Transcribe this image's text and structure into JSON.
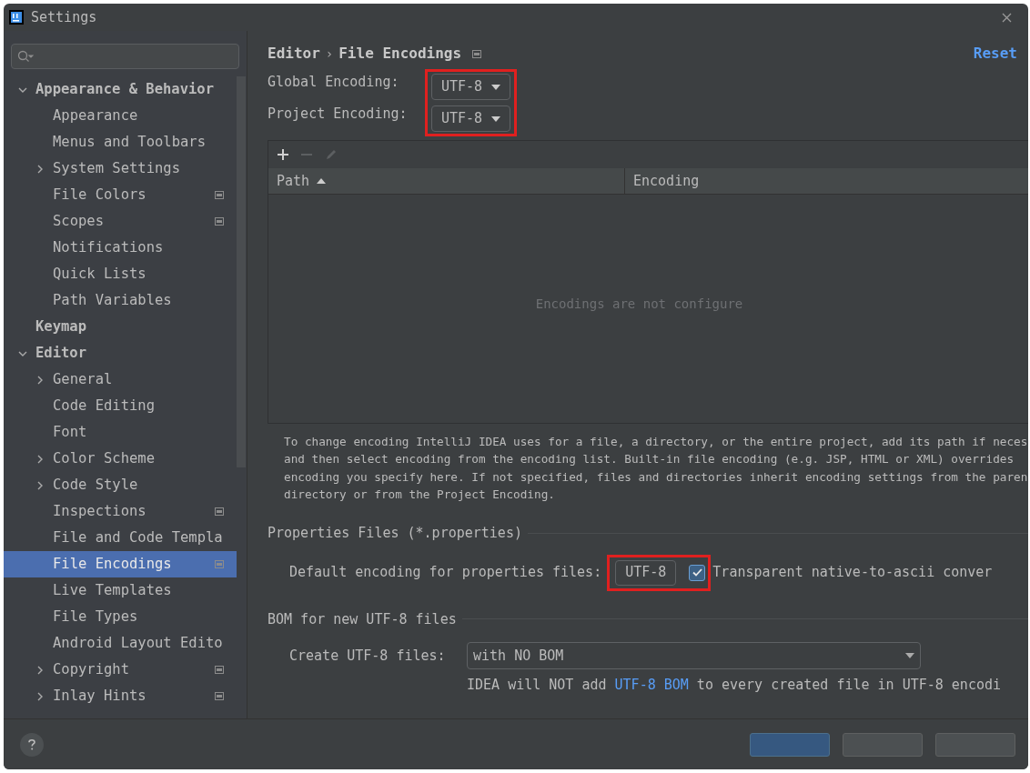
{
  "window": {
    "title": "Settings"
  },
  "sidebar": {
    "items": [
      {
        "label": "Appearance & Behavior",
        "bold": true,
        "expanded": true,
        "selected": false,
        "children": [
          {
            "label": "Appearance",
            "selected": false
          },
          {
            "label": "Menus and Toolbars",
            "selected": false
          },
          {
            "label": "System Settings",
            "expanded": false,
            "selected": false
          },
          {
            "label": "File Colors",
            "project_scope": true,
            "selected": false
          },
          {
            "label": "Scopes",
            "project_scope": true,
            "selected": false
          },
          {
            "label": "Notifications",
            "selected": false
          },
          {
            "label": "Quick Lists",
            "selected": false
          },
          {
            "label": "Path Variables",
            "selected": false
          }
        ]
      },
      {
        "label": "Keymap",
        "bold": true,
        "selected": false
      },
      {
        "label": "Editor",
        "bold": true,
        "expanded": true,
        "selected": false,
        "children": [
          {
            "label": "General",
            "expanded": false,
            "selected": false
          },
          {
            "label": "Code Editing",
            "selected": false
          },
          {
            "label": "Font",
            "selected": false
          },
          {
            "label": "Color Scheme",
            "expanded": false,
            "selected": false
          },
          {
            "label": "Code Style",
            "expanded": false,
            "selected": false
          },
          {
            "label": "Inspections",
            "project_scope": true,
            "selected": false
          },
          {
            "label": "File and Code Templa",
            "selected": false
          },
          {
            "label": "File Encodings",
            "project_scope": true,
            "selected": true
          },
          {
            "label": "Live Templates",
            "selected": false
          },
          {
            "label": "File Types",
            "selected": false
          },
          {
            "label": "Android Layout Edito",
            "selected": false
          },
          {
            "label": "Copyright",
            "expanded": false,
            "project_scope": true,
            "selected": false
          },
          {
            "label": "Inlay Hints",
            "expanded": false,
            "project_scope": true,
            "selected": false
          }
        ]
      }
    ]
  },
  "breadcrumb": [
    "Editor",
    "File Encodings"
  ],
  "breadcrumb_separator": "›",
  "reset_link": "Reset",
  "encodings": [
    {
      "label": "Global Encoding:",
      "value": "UTF-8"
    },
    {
      "label": "Project Encoding:",
      "value": "UTF-8"
    }
  ],
  "table": {
    "columns": [
      {
        "label": "Path",
        "sorted": true
      },
      {
        "label": "Encoding",
        "sorted": false
      }
    ],
    "empty_text": "Encodings are not configure"
  },
  "description": [
    "To change encoding IntelliJ IDEA uses for a file, a directory, or the entire project, add its path if neces",
    "and then select encoding from the encoding list. Built-in file encoding (e.g. JSP, HTML or XML) overrides",
    "encoding you specify here. If not specified, files and directories inherit encoding settings from the paren",
    "directory or from the Project Encoding."
  ],
  "properties": {
    "title": "Properties Files (*.properties)",
    "label": "Default encoding for properties files:",
    "value": "UTF-8",
    "checkbox": {
      "label": "Transparent native-to-ascii conver",
      "checked": true
    }
  },
  "bom": {
    "title": "BOM for new UTF-8 files",
    "label": "Create UTF-8 files:",
    "value": "with NO BOM",
    "note_before": "IDEA will NOT add ",
    "note_link": "UTF-8 BOM",
    "note_after": " to every created file in UTF-8 encodi"
  },
  "footer_buttons": [
    {
      "primary": true
    },
    {
      "primary": false
    },
    {
      "primary": false
    }
  ]
}
